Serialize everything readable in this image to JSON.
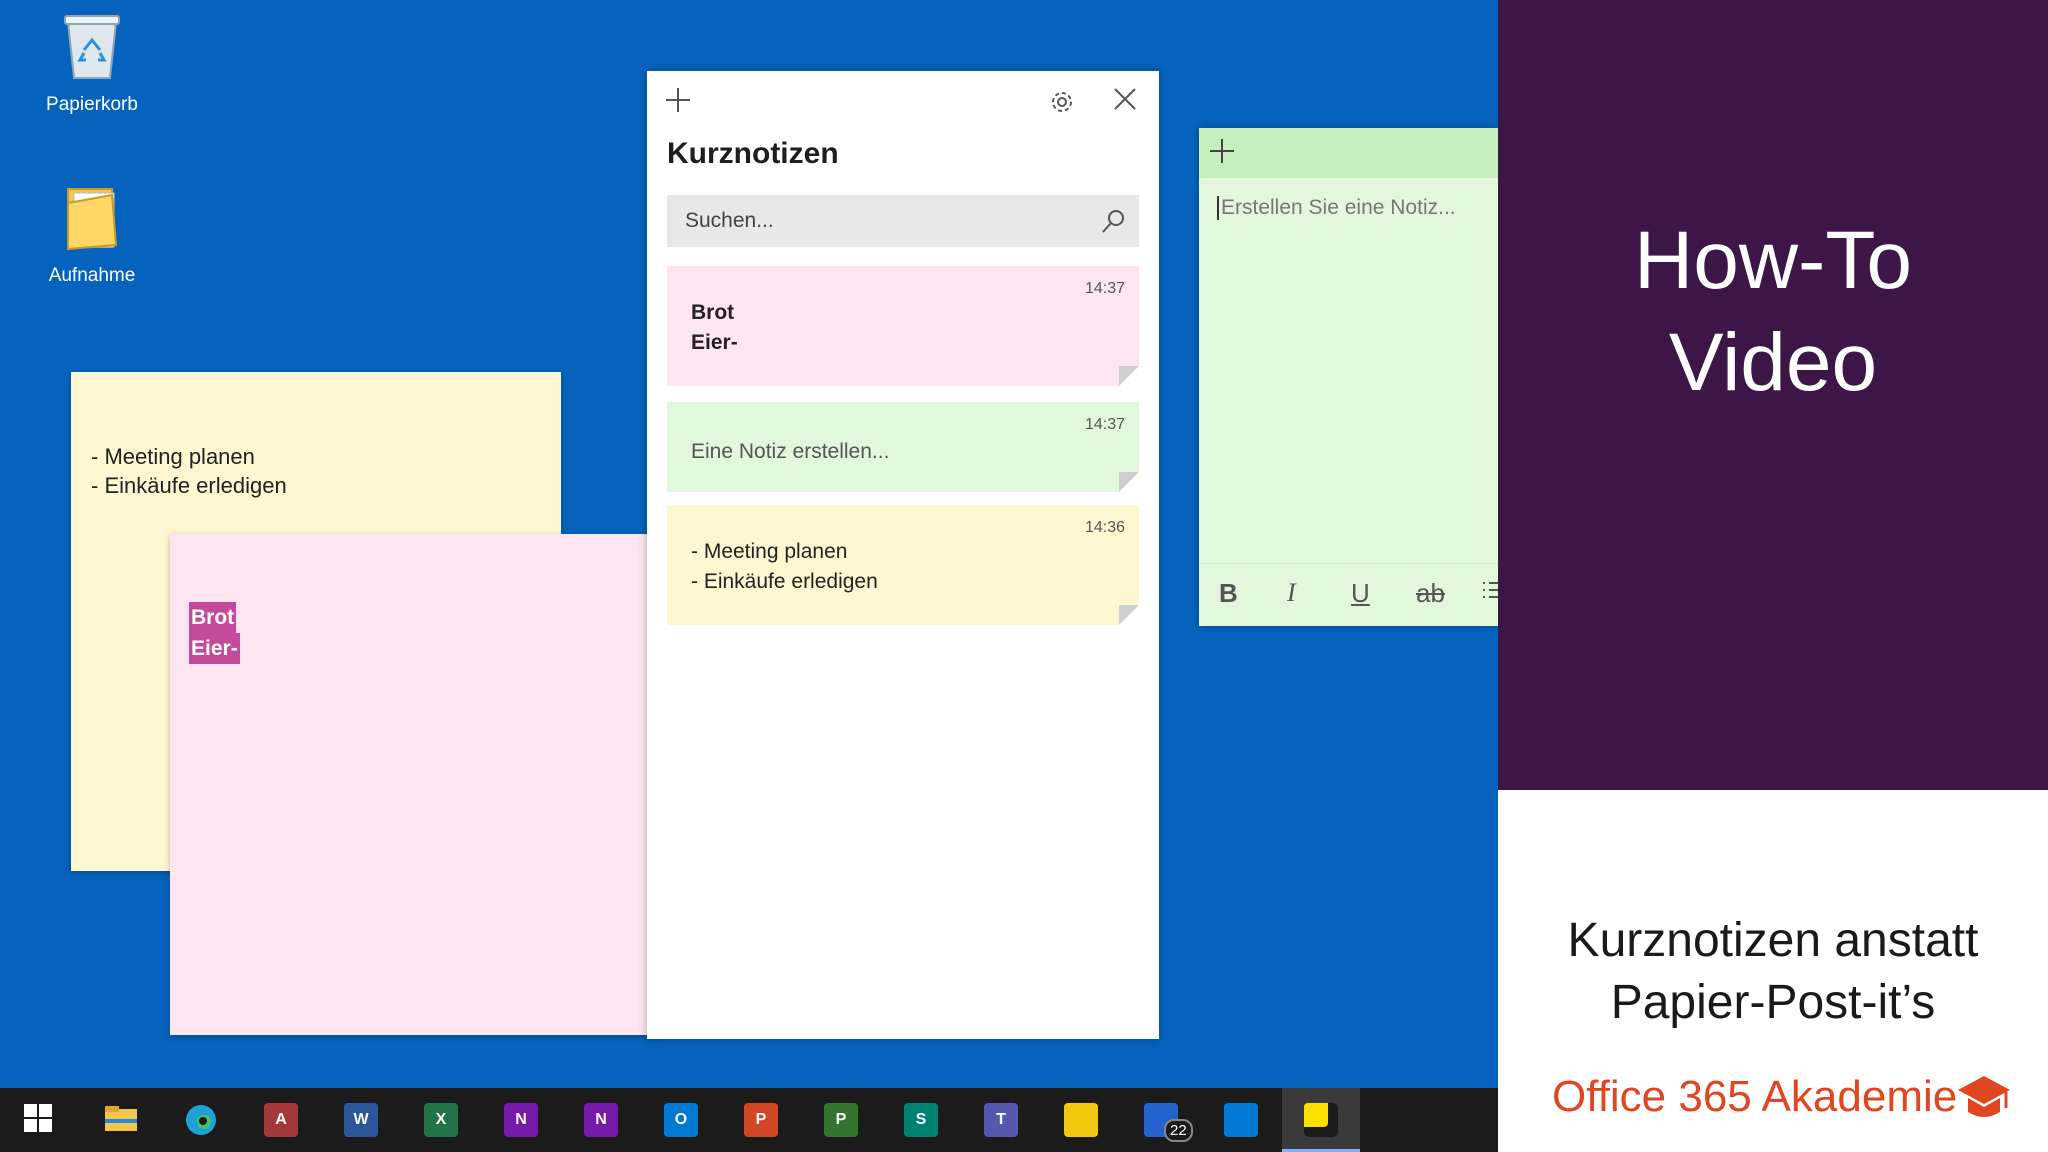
{
  "desktop": {
    "icons": [
      {
        "label": "Papierkorb",
        "icon": "recycle-bin-icon"
      },
      {
        "label": "Aufnahme",
        "icon": "folder-icon"
      }
    ],
    "notes": {
      "yellow_text": "- Meeting planen\n- Einkäufe erledigen",
      "pink_line1": "Brot",
      "pink_line2": "Eier-"
    }
  },
  "list_window": {
    "title": "Kurznotizen",
    "search_placeholder": "Suchen...",
    "notes": [
      {
        "time": "14:37",
        "text": "Brot\nEier-",
        "color": "#ffe4f1"
      },
      {
        "time": "14:37",
        "text": "Eine Notiz erstellen...",
        "color": "#e1f8dc"
      },
      {
        "time": "14:36",
        "text": "- Meeting planen\n- Einkäufe erledigen",
        "color": "#fff7d1"
      }
    ]
  },
  "green_note": {
    "placeholder": "Erstellen Sie eine Notiz...",
    "format": {
      "bold": "B",
      "italic": "I",
      "underline": "U",
      "strike": "ab"
    }
  },
  "promo": {
    "heading_line1": "How-To",
    "heading_line2": "Video",
    "sub_line1": "Kurznotizen anstatt",
    "sub_line2": "Papier-Post-it’s",
    "brand": "Office 365 Akademie",
    "colors": {
      "panel": "#3b1646",
      "brand": "#e0461f"
    }
  },
  "taskbar": {
    "apps": [
      {
        "name": "start",
        "letter": ""
      },
      {
        "name": "file-explorer",
        "letter": ""
      },
      {
        "name": "edge",
        "letter": ""
      },
      {
        "name": "access",
        "letter": "A",
        "color": "#a4373a"
      },
      {
        "name": "word",
        "letter": "W",
        "color": "#2b579a"
      },
      {
        "name": "excel",
        "letter": "X",
        "color": "#217346"
      },
      {
        "name": "onenote",
        "letter": "N",
        "color": "#7719aa"
      },
      {
        "name": "onenote-2",
        "letter": "N",
        "color": "#7719aa"
      },
      {
        "name": "outlook",
        "letter": "O",
        "color": "#0078d4"
      },
      {
        "name": "powerpoint",
        "letter": "P",
        "color": "#d24726"
      },
      {
        "name": "project",
        "letter": "P",
        "color": "#31752f"
      },
      {
        "name": "sway",
        "letter": "S",
        "color": "#008272"
      },
      {
        "name": "teams",
        "letter": "T",
        "color": "#5558af"
      },
      {
        "name": "power-bi",
        "letter": "",
        "color": "#f2c811"
      },
      {
        "name": "todo",
        "letter": "",
        "color": "#2564cf",
        "badge": "22"
      },
      {
        "name": "whiteboard",
        "letter": "",
        "color": "#0078d4"
      },
      {
        "name": "sticky-notes",
        "letter": "",
        "color": "#fce100"
      }
    ]
  }
}
